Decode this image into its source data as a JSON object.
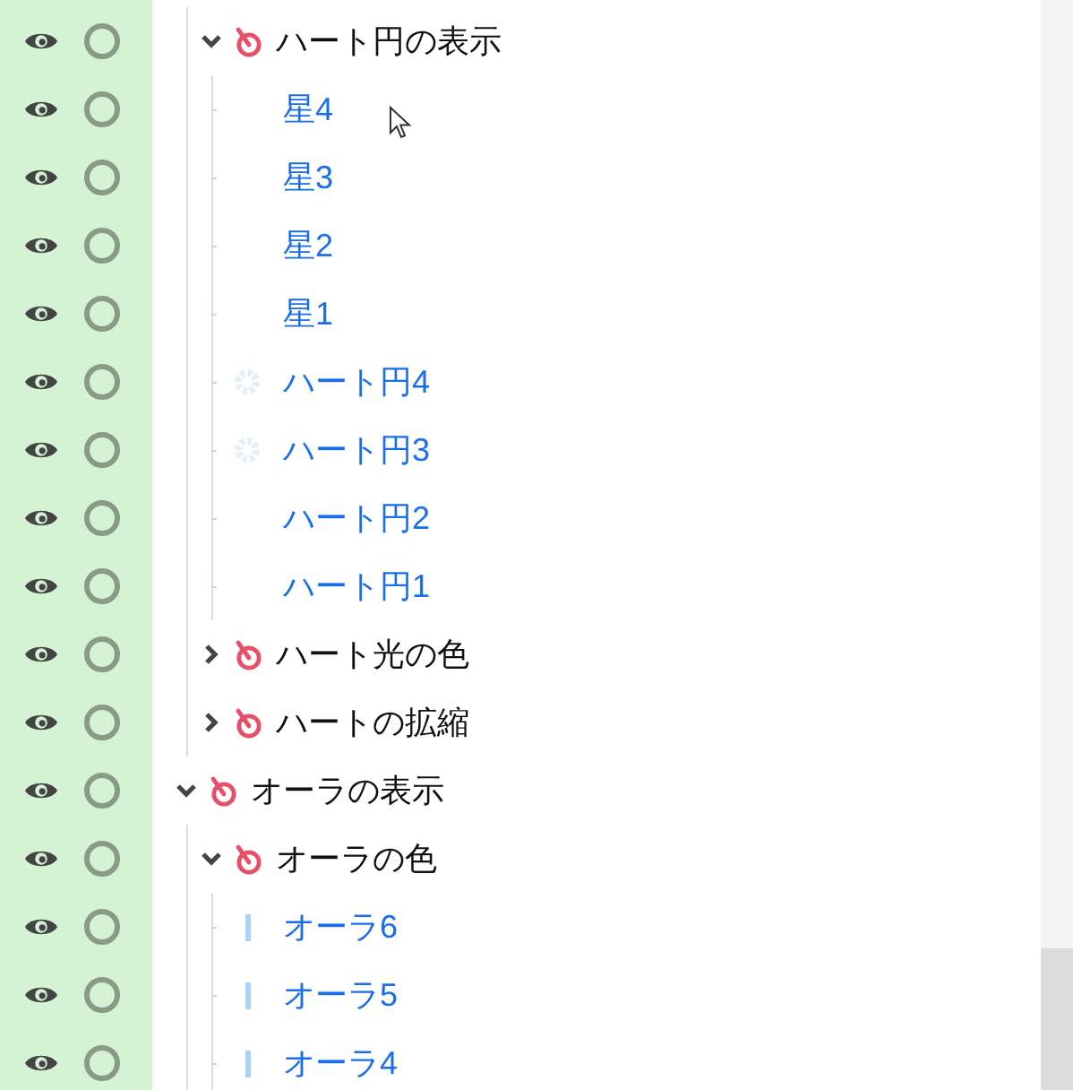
{
  "tree": [
    {
      "children": [
        {
          "kind": "group",
          "label": "ハート円の表示",
          "expanded": true,
          "children": [
            {
              "kind": "plain",
              "label": "星4"
            },
            {
              "kind": "plain",
              "label": "星3"
            },
            {
              "kind": "plain",
              "label": "星2"
            },
            {
              "kind": "plain",
              "label": "星1"
            },
            {
              "kind": "ring",
              "label": "ハート円4"
            },
            {
              "kind": "ring",
              "label": "ハート円3"
            },
            {
              "kind": "plain",
              "label": "ハート円2"
            },
            {
              "kind": "plain",
              "label": "ハート円1"
            }
          ]
        },
        {
          "kind": "group",
          "label": "ハート光の色",
          "expanded": false
        },
        {
          "kind": "group",
          "label": "ハートの拡縮",
          "expanded": false
        }
      ]
    },
    {
      "kind": "group",
      "label": "オーラの表示",
      "expanded": true,
      "children": [
        {
          "kind": "group",
          "label": "オーラの色",
          "expanded": true,
          "children": [
            {
              "kind": "bar",
              "label": "オーラ6"
            },
            {
              "kind": "bar",
              "label": "オーラ5"
            },
            {
              "kind": "bar",
              "label": "オーラ4"
            }
          ]
        }
      ]
    }
  ]
}
